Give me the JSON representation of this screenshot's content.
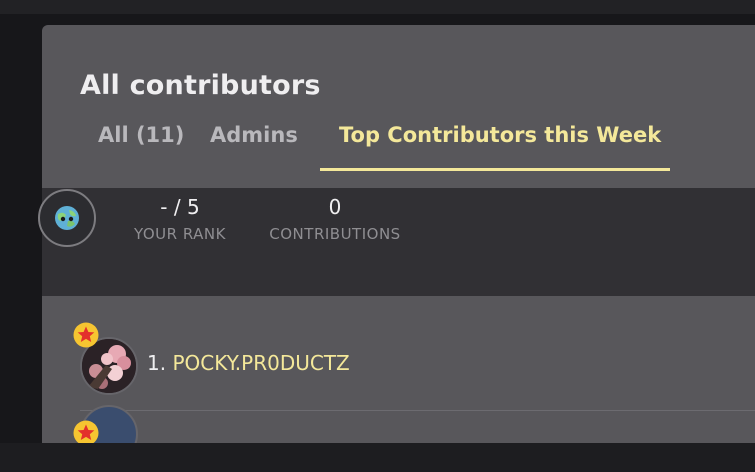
{
  "panel": {
    "title": "All contributors"
  },
  "tabs": [
    {
      "label": "All (11)"
    },
    {
      "label": "Admins"
    },
    {
      "label": "Top Contributors this Week",
      "active": true
    }
  ],
  "my_stats": {
    "rank_value": "- / 5",
    "rank_label": "YOUR RANK",
    "contributions_value": "0",
    "contributions_label": "CONTRIBUTIONS"
  },
  "contributors": [
    {
      "rank": "1.",
      "name": "POCKY.PR0DUCTZ",
      "icon": "star-badge-icon"
    }
  ],
  "colors": {
    "accent": "#f4e89a",
    "panel_bg": "#58575b",
    "strip_bg": "#313034",
    "badge": "#f6c531",
    "badge_star": "#e3312c"
  }
}
